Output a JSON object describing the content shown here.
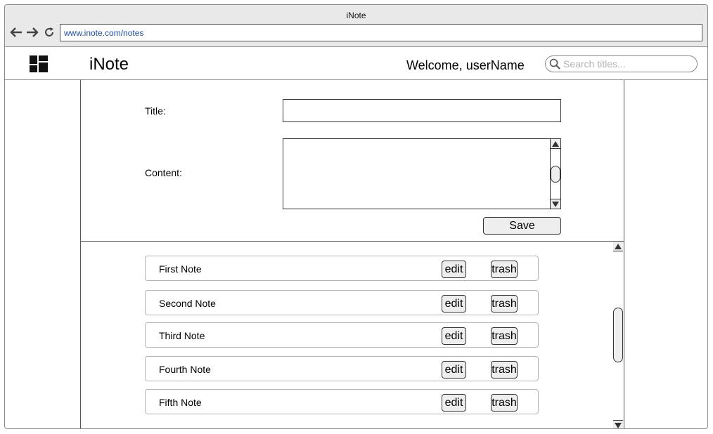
{
  "window": {
    "title": "iNote"
  },
  "browser": {
    "url": "www.inote.com/notes"
  },
  "header": {
    "brand": "iNote",
    "welcome": "Welcome, userName",
    "search": {
      "placeholder": "Search titles...",
      "value": ""
    }
  },
  "form": {
    "title_label": "Title:",
    "title_value": "",
    "content_label": "Content:",
    "content_value": "",
    "save_label": "Save"
  },
  "notes": {
    "edit_label": "edit",
    "trash_label": "trash",
    "items": [
      {
        "title": "First Note"
      },
      {
        "title": "Second Note"
      },
      {
        "title": "Third Note"
      },
      {
        "title": "Fourth Note"
      },
      {
        "title": "Fifth Note"
      }
    ]
  },
  "icons": {
    "back": "arrow-left-icon",
    "forward": "arrow-right-icon",
    "reload": "reload-icon",
    "logo": "dashboard-grid-icon",
    "search": "search-icon"
  }
}
